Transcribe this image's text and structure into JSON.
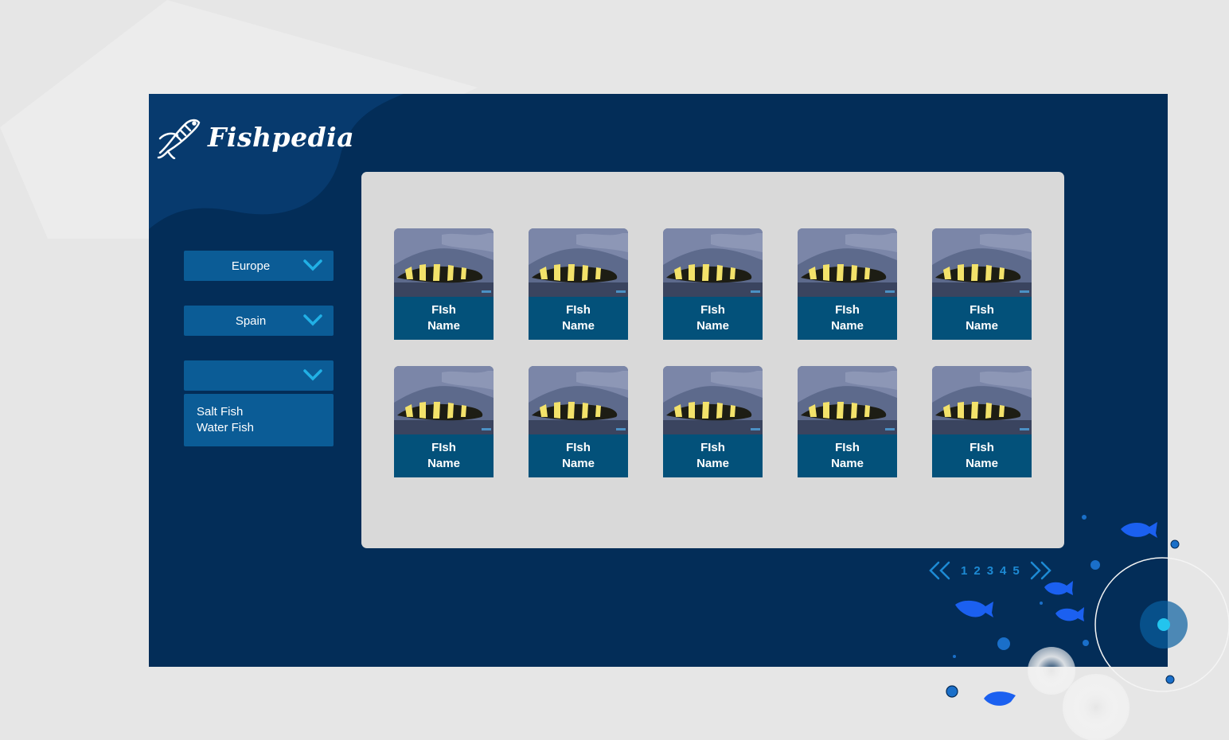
{
  "app": {
    "title": "Fishpedia"
  },
  "filters": {
    "continent": {
      "value": "Europe"
    },
    "country": {
      "value": "Spain"
    },
    "type": {
      "value": "",
      "options": [
        "Salt Fish",
        "Water Fish"
      ]
    }
  },
  "cards": [
    {
      "line1": "FIsh",
      "line2": "Name"
    },
    {
      "line1": "FIsh",
      "line2": "Name"
    },
    {
      "line1": "FIsh",
      "line2": "Name"
    },
    {
      "line1": "FIsh",
      "line2": "Name"
    },
    {
      "line1": "FIsh",
      "line2": "Name"
    },
    {
      "line1": "FIsh",
      "line2": "Name"
    },
    {
      "line1": "FIsh",
      "line2": "Name"
    },
    {
      "line1": "FIsh",
      "line2": "Name"
    },
    {
      "line1": "FIsh",
      "line2": "Name"
    },
    {
      "line1": "FIsh",
      "line2": "Name"
    }
  ],
  "pagination": {
    "pages": [
      "1",
      "2",
      "3",
      "4",
      "5"
    ]
  },
  "colors": {
    "app_background": "#032d58",
    "dropdown": "#0b5c96",
    "card_caption": "#03517a",
    "panel": "#d9d9d9",
    "accent": "#1d8ad4"
  },
  "icons": {
    "logo": "fish-logo-icon",
    "dropdown": "chevron-down-icon",
    "prev": "double-chevron-left-icon",
    "next": "double-chevron-right-icon"
  }
}
